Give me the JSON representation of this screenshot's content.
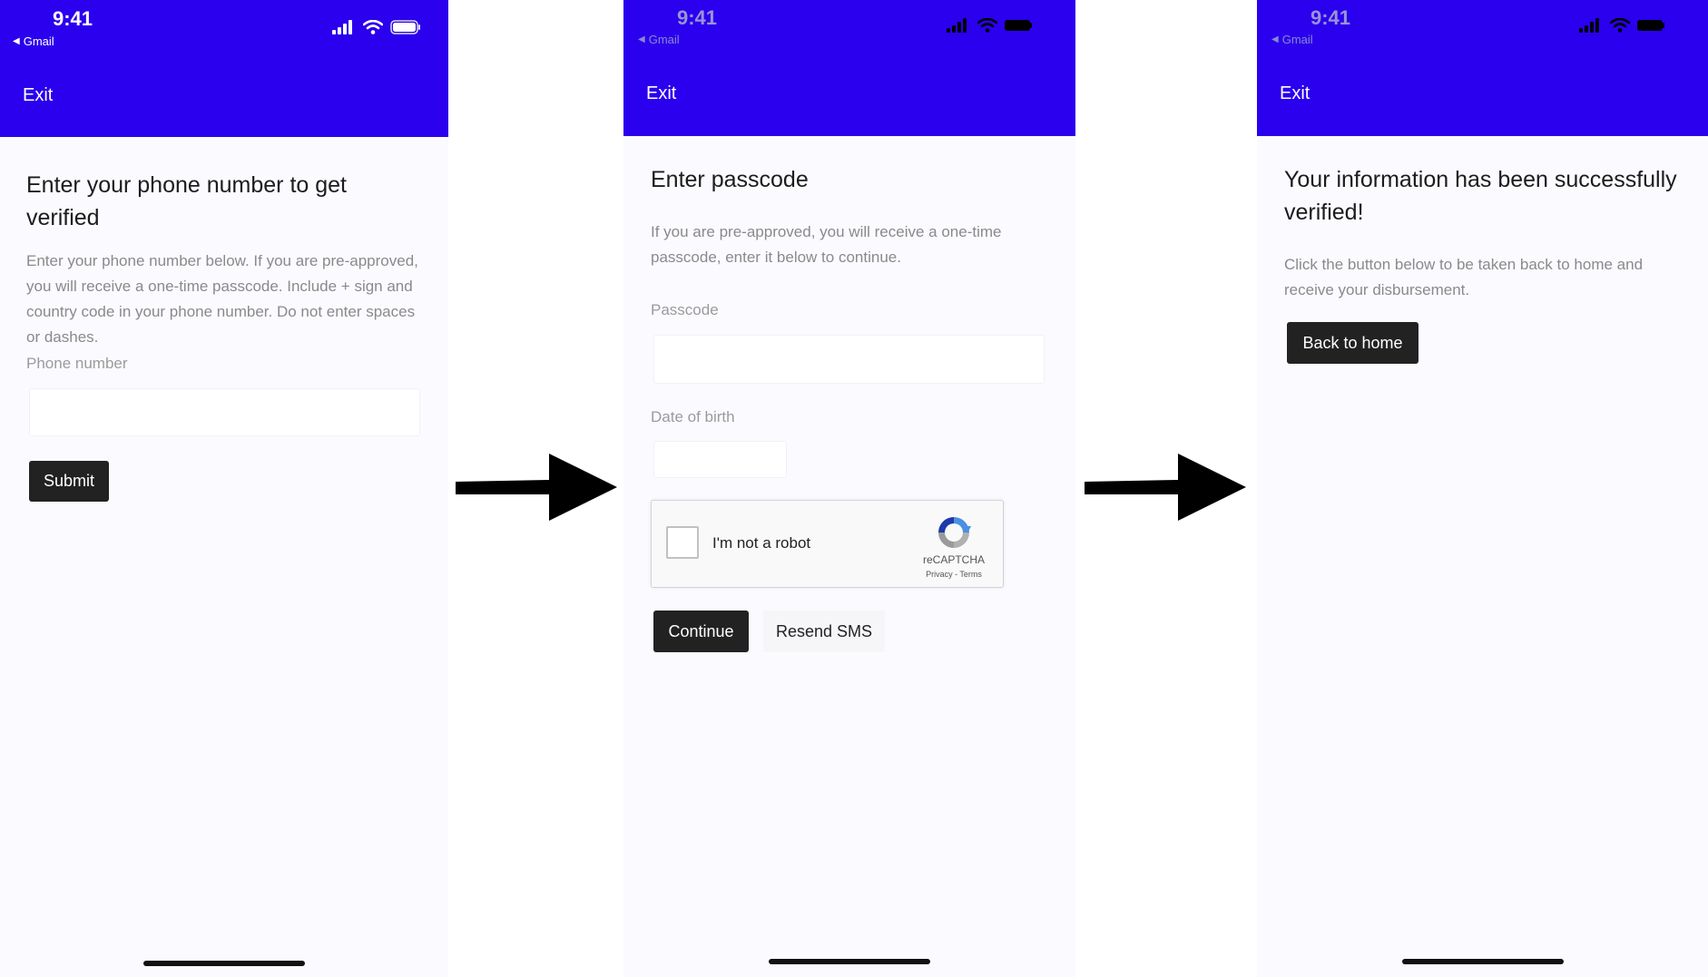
{
  "status_bar": {
    "time": "9:41",
    "back_app": "Gmail"
  },
  "header": {
    "exit_label": "Exit"
  },
  "screen1": {
    "title": "Enter your phone number to get verified",
    "description": "Enter your phone number below. If you are pre-approved, you will receive a one-time passcode. Include + sign and country code in your phone number. Do not enter spaces or dashes.",
    "phone_label": "Phone number",
    "phone_value": "",
    "submit_label": "Submit"
  },
  "screen2": {
    "title": "Enter passcode",
    "description": "If you are pre-approved, you will receive a one-time passcode, enter it below to continue.",
    "passcode_label": "Passcode",
    "passcode_value": "",
    "dob_label": "Date of birth",
    "dob_value": "",
    "recaptcha": {
      "label": "I'm not a robot",
      "brand": "reCAPTCHA",
      "links": "Privacy - Terms"
    },
    "continue_label": "Continue",
    "resend_label": "Resend SMS"
  },
  "screen3": {
    "title": "Your information has been successfully verified!",
    "description": "Click the button below to be taken back to home and receive your disbursement.",
    "back_label": "Back to home"
  },
  "icons": {
    "signal": "cellular-signal-icon",
    "wifi": "wifi-icon",
    "battery": "battery-icon",
    "arrow": "right-arrow-icon",
    "recaptcha": "recaptcha-logo-icon"
  },
  "colors": {
    "header": "#2a00ee",
    "button_dark": "#222222",
    "page_bg": "#fbfaff"
  }
}
